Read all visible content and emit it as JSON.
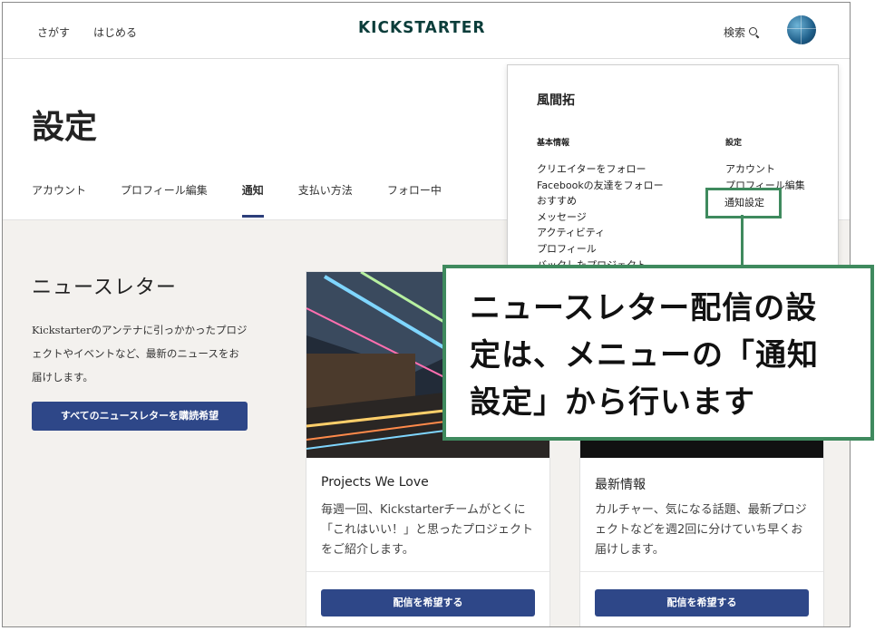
{
  "topnav": {
    "explore": "さがす",
    "start": "はじめる",
    "logo": "KICKSTARTER",
    "search_label": "検索"
  },
  "settings": {
    "title": "設定",
    "tabs": [
      {
        "label": "アカウント"
      },
      {
        "label": "プロフィール編集"
      },
      {
        "label": "通知"
      },
      {
        "label": "支払い方法"
      },
      {
        "label": "フォロー中"
      }
    ]
  },
  "newsletter": {
    "title": "ニュースレター",
    "description": "Kickstarterのアンテナに引っかかったプロジェクトやイベントなど、最新のニュースをお届けします。",
    "subscribe_all": "すべてのニュースレターを購読希望"
  },
  "cards": [
    {
      "title": "Projects We Love",
      "text": "毎週一回、Kickstarterチームがとくに「これはいい！」と思ったプロジェクトをご紹介します。",
      "button": "配信を希望する"
    },
    {
      "title": "最新情報",
      "text": "カルチャー、気になる話題、最新プロジェクトなどを週2回に分けていち早くお届けします。",
      "button": "配信を希望する"
    }
  ],
  "dropdown": {
    "user_name": "風間拓",
    "basic_heading": "基本情報",
    "settings_heading": "設定",
    "basic_items": [
      "クリエイターをフォロー",
      "Facebookの友達をフォロー",
      "おすすめ",
      "メッセージ",
      "アクティビティ",
      "プロフィール",
      "バックしたプロジェクト"
    ],
    "settings_items": [
      "アカウント",
      "プロフィール編集"
    ],
    "notify_settings": "通知設定"
  },
  "callout": {
    "text": "ニュースレター配信の設定は、メニューの「通知設定」から行います"
  },
  "colors": {
    "accent_button": "#2e4788",
    "callout_border": "#3f8a5e",
    "logo": "#0b3d3a"
  }
}
